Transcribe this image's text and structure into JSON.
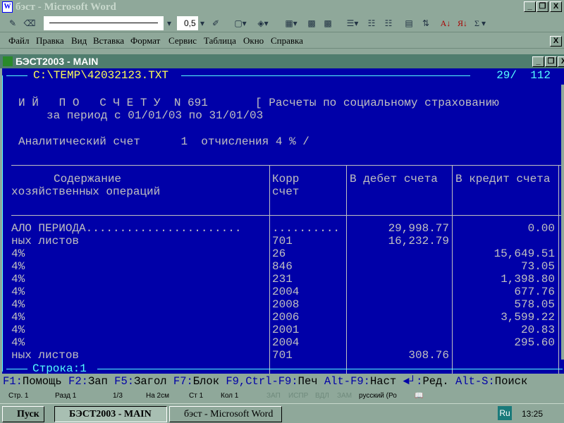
{
  "word": {
    "title": "бэст - Microsoft Word",
    "line_width": "0,5",
    "menu": [
      "Файл",
      "Правка",
      "Вид",
      "Вставка",
      "Формат",
      "Сервис",
      "Таблица",
      "Окно",
      "Справка"
    ],
    "status": {
      "page": "Стр. 1",
      "section": "Разд 1",
      "pages": "1/3",
      "at": "На 2см",
      "line": "Ст 1",
      "col": "Кол 1",
      "rec": "ЗАП",
      "trk": "ИСПР",
      "ext": "ВДЛ",
      "ovr": "ЗАМ",
      "lang": "русский (Ро"
    }
  },
  "dos": {
    "title": "БЭСТ2003 - MAIN",
    "file": "C:\\TEMP\\42032123.TXT",
    "position": "29/  112",
    "report_line1": "И Й   П О   С Ч Е Т У  N 691       [ Расчеты по социальному страхованию",
    "report_line2": "за период с 01/01/03 по 31/01/03",
    "analytic": "Аналитический счет      1  отчисления 4 % /",
    "headers": {
      "desc1": "Содержание",
      "desc2": "хозяйственных операций",
      "korr1": "Корр",
      "korr2": "счет",
      "debit": "В дебет счета",
      "credit": "В кредит счета"
    },
    "rows": [
      {
        "desc": "АЛО ПЕРИОДА.......................",
        "korr": "..........",
        "debit": "29,998.77",
        "credit": "0.00"
      },
      {
        "desc": "ных листов",
        "korr": "701",
        "debit": "16,232.79",
        "credit": ""
      },
      {
        "desc": "4%",
        "korr": "26",
        "debit": "",
        "credit": "15,649.51"
      },
      {
        "desc": "4%",
        "korr": "846",
        "debit": "",
        "credit": "73.05"
      },
      {
        "desc": "4%",
        "korr": "231",
        "debit": "",
        "credit": "1,398.80"
      },
      {
        "desc": "4%",
        "korr": "2004",
        "debit": "",
        "credit": "677.76"
      },
      {
        "desc": "4%",
        "korr": "2008",
        "debit": "",
        "credit": "578.05"
      },
      {
        "desc": "4%",
        "korr": "2006",
        "debit": "",
        "credit": "3,599.22"
      },
      {
        "desc": "4%",
        "korr": "2001",
        "debit": "",
        "credit": "20.83"
      },
      {
        "desc": "4%",
        "korr": "2004",
        "debit": "",
        "credit": "295.60"
      },
      {
        "desc": "ных листов",
        "korr": "701",
        "debit": "308.76",
        "credit": ""
      }
    ],
    "status_line": "Строка:1",
    "fkeys": [
      [
        "F1:",
        "Помощь"
      ],
      [
        "F2:",
        "Зап"
      ],
      [
        "F5:",
        "Загол"
      ],
      [
        "F7:",
        "Блок"
      ],
      [
        "F9,Ctrl-F9:",
        "Печ"
      ],
      [
        "Alt-F9:",
        "Наст"
      ],
      [
        "◄┘:",
        "Ред."
      ],
      [
        "Alt-S:",
        "Поиск"
      ]
    ]
  },
  "taskbar": {
    "start": "Пуск",
    "tasks": [
      "БЭСТ2003 - MAIN",
      "бэст - Microsoft Word"
    ],
    "lang": "Ru",
    "clock": "13:25"
  }
}
